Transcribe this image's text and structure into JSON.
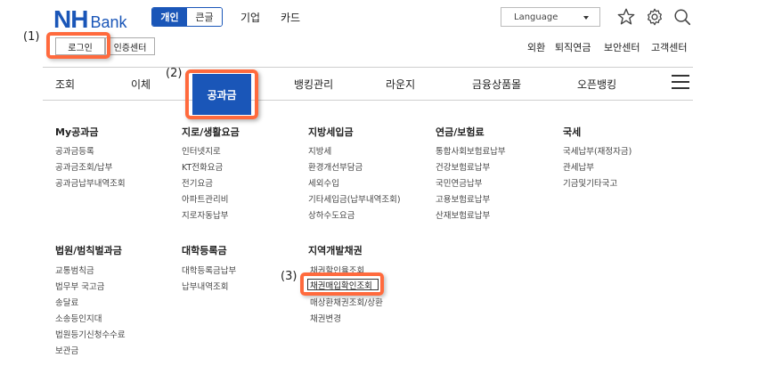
{
  "header": {
    "logo_nh": "NH",
    "logo_bank": "Bank",
    "mode_personal": "개인",
    "mode_large": "큰글",
    "link_corporate": "기업",
    "link_card": "카드",
    "language_label": "Language",
    "icons": [
      "star-icon",
      "gear-icon",
      "search-icon"
    ]
  },
  "login_row": {
    "login_button": "로그인",
    "cert_button": "인증센터",
    "util_links": [
      "외환",
      "퇴직연금",
      "보안센터",
      "고객센터"
    ]
  },
  "annotations": [
    "(1)",
    "(2)",
    "(3)"
  ],
  "nav": {
    "items": [
      "조회",
      "이체",
      "공과금",
      "뱅킹관리",
      "라운지",
      "금융상품몰",
      "오픈뱅킹"
    ],
    "active_index": 2
  },
  "menu": {
    "row1": [
      {
        "head": "My공과금",
        "links": [
          "공과금등록",
          "공과금조회/납부",
          "공과금납부내역조회"
        ]
      },
      {
        "head": "지로/생활요금",
        "links": [
          "인터넷지로",
          "KT전화요금",
          "전기요금",
          "아파트관리비",
          "지로자동납부"
        ]
      },
      {
        "head": "지방세입금",
        "links": [
          "지방세",
          "환경개선부담금",
          "세외수입",
          "기타세입금(납부내역조회)",
          "상하수도요금"
        ]
      },
      {
        "head": "연금/보험료",
        "links": [
          "통합사회보험료납부",
          "건강보험료납부",
          "국민연금납부",
          "고용보험료납부",
          "산재보험료납부"
        ]
      },
      {
        "head": "국세",
        "links": [
          "국세납부(재정자금)",
          "관세납부",
          "기금및기타국고"
        ]
      }
    ],
    "row2": [
      {
        "head": "법원/범칙벌과금",
        "links": [
          "교통범칙금",
          "법무부 국고금",
          "송달료",
          "소송등인지대",
          "법원등기신청수수료",
          "보관금"
        ]
      },
      {
        "head": "대학등록금",
        "links": [
          "대학등록금납부",
          "납부내역조회"
        ]
      },
      {
        "head": "지역개발채권",
        "links": [
          "채권할인율조회",
          "채권매입확인조회",
          "매상환채권조회/상환",
          "채권변경"
        ]
      }
    ]
  }
}
